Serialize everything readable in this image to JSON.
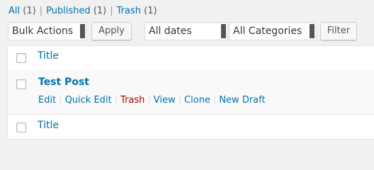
{
  "filters": {
    "views": [
      {
        "label": "All",
        "count": "(1)"
      },
      {
        "label": "Published",
        "count": "(1)"
      },
      {
        "label": "Trash",
        "count": "(1)"
      }
    ],
    "separator": "|"
  },
  "tablenav": {
    "bulk_actions": "Bulk Actions",
    "apply": "Apply",
    "dates": "All dates",
    "categories": "All Categories",
    "filter": "Filter"
  },
  "table": {
    "column_title": "Title",
    "post": {
      "title": "Test Post",
      "actions": [
        "Edit",
        "Quick Edit",
        "Trash",
        "View",
        "Clone",
        "New Draft"
      ],
      "separator": "|"
    }
  },
  "colors": {
    "link": "#0073aa",
    "trash": "#aa0000",
    "background": "#f1f1f1"
  }
}
